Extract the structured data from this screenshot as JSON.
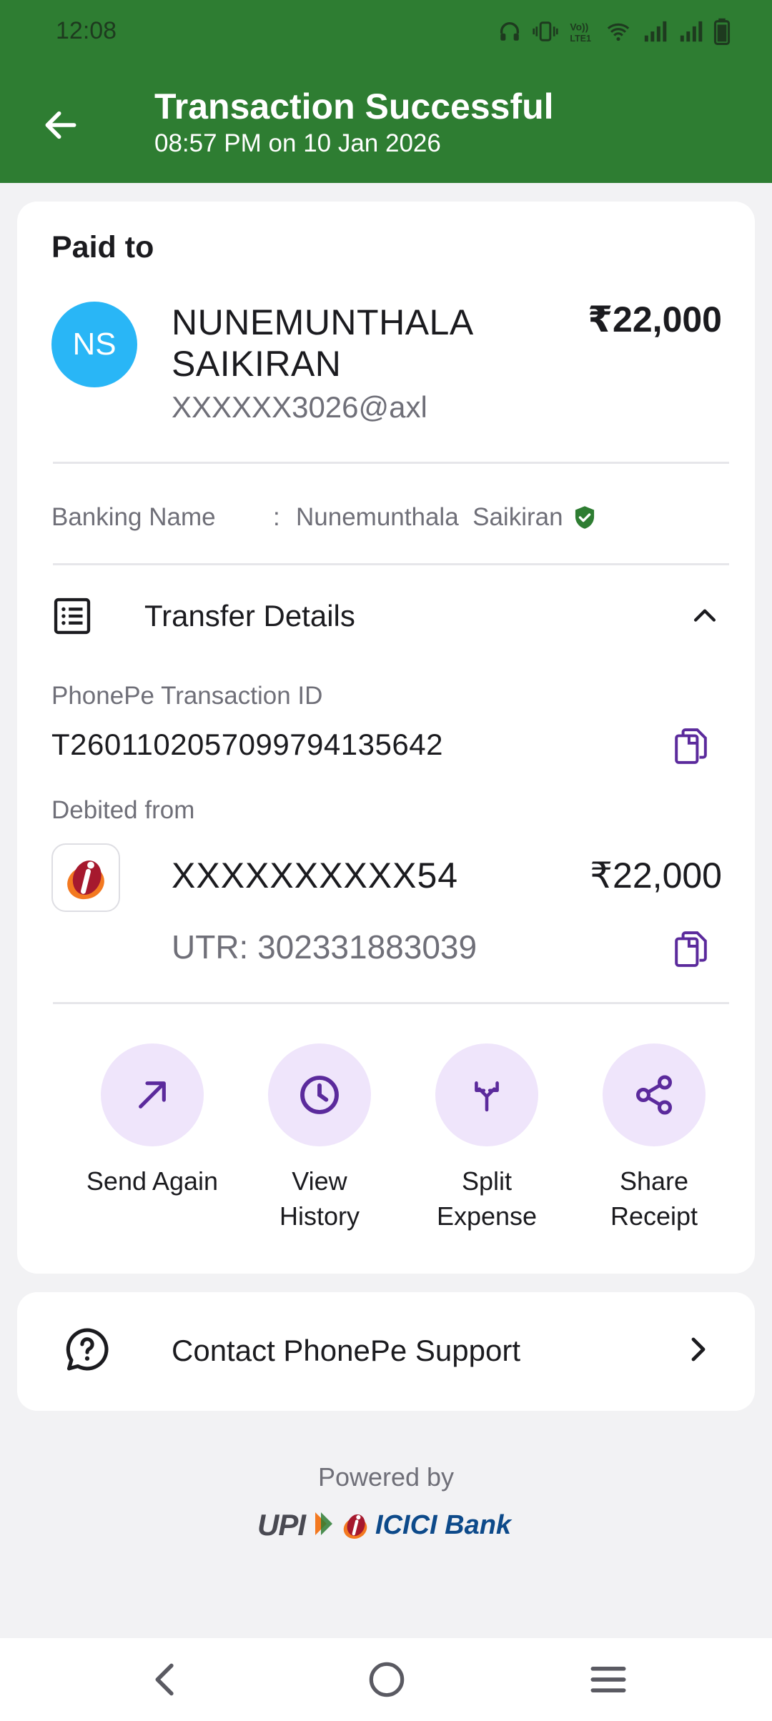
{
  "status_bar": {
    "time": "12:08",
    "icons": [
      "headphones-icon",
      "vibrate-icon",
      "volte-icon",
      "wifi-icon",
      "signal-1-icon",
      "signal-2-icon",
      "battery-icon"
    ]
  },
  "header": {
    "title": "Transaction Successful",
    "subtitle": "08:57 PM on 10 Jan 2026",
    "back_icon": "arrow-left-icon",
    "background_color": "#2e7d32"
  },
  "payment": {
    "paid_to_label": "Paid to",
    "avatar_initials": "NS",
    "avatar_color": "#29b6f6",
    "payee_name": "NUNEMUNTHALA SAIKIRAN",
    "payee_vpa": "XXXXXX3026@axl",
    "amount": "₹22,000"
  },
  "banking": {
    "label": "Banking Name",
    "separator": ":",
    "value": "Nunemunthala  Saikiran",
    "verified_icon": "verified-shield-icon"
  },
  "transfer": {
    "title": "Transfer Details",
    "txn_label": "PhonePe Transaction ID",
    "txn_id": "T2601102057099794135642",
    "debited_label": "Debited from",
    "account": "XXXXXXXXXX54",
    "debit_amount": "₹22,000",
    "utr": "UTR: 302331883039"
  },
  "actions": [
    {
      "label": "Send Again",
      "icon": "arrow-up-right-icon"
    },
    {
      "label": "View History",
      "icon": "clock-icon"
    },
    {
      "label": "Split Expense",
      "icon": "split-icon"
    },
    {
      "label": "Share Receipt",
      "icon": "share-icon"
    }
  ],
  "support": {
    "label": "Contact PhonePe Support",
    "icon": "question-chat-icon"
  },
  "footer": {
    "powered_by": "Powered by",
    "upi_text": "UPI",
    "bank_text": "ICICI Bank"
  },
  "accent_color": "#5b2a9c"
}
